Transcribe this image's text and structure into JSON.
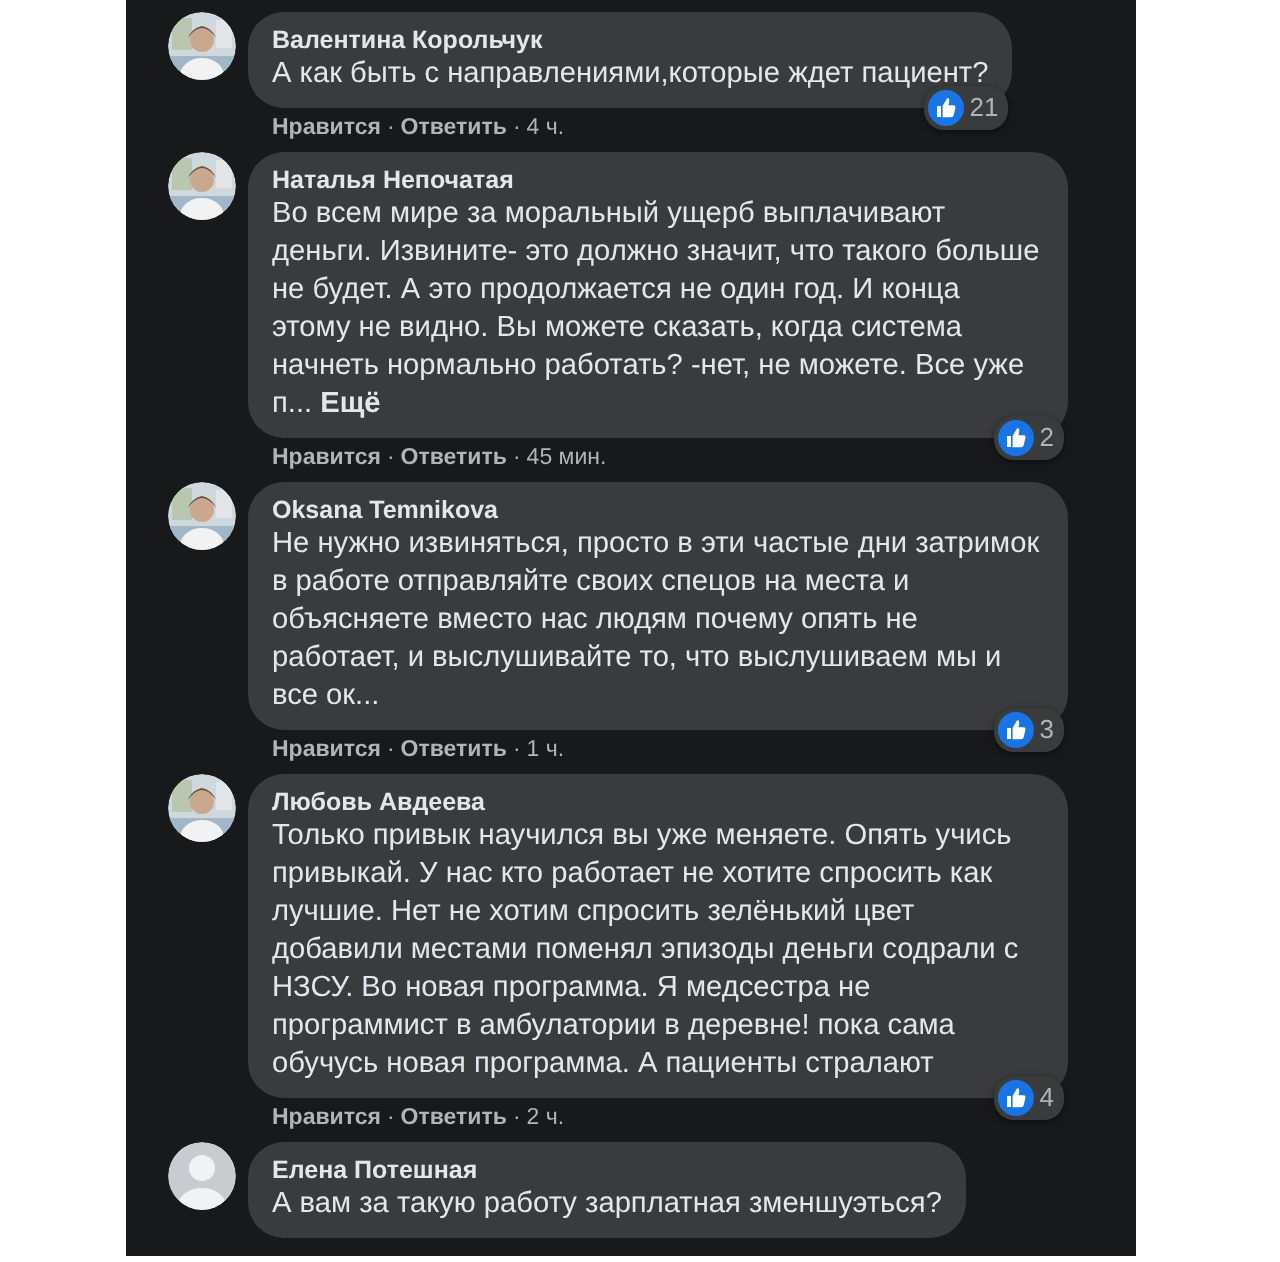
{
  "comments": [
    {
      "author": "Валентина Корольчук",
      "text": "А как быть с направлениями,которые ждет пациент?",
      "likes": "21",
      "like": "Нравится",
      "sep": "·",
      "reply": "Ответить",
      "time": "4 ч."
    },
    {
      "author": "Наталья Непочатая",
      "text": "Во всем мире за моральный ущерб выплачивают деньги. Извините- это должно значит, что такого больше не будет. А это продолжается не один год. И конца этому не видно. Вы можете сказать, когда система начнеть нормально работать? -нет, не можете. Все уже п... **Ещё**",
      "likes": "2",
      "like": "Нравится",
      "sep": "·",
      "reply": "Ответить",
      "time": "45 мин."
    },
    {
      "author": "Oksana Temnikova",
      "text": "Не нужно извиняться, просто в эти частые дни затримок в работе отправляйте своих спецов на места и объясняете вместо нас людям почему опять не работает, и выслушивайте то, что выслушиваем мы и все ок...",
      "likes": "3",
      "like": "Нравится",
      "sep": "·",
      "reply": "Ответить",
      "time": "1 ч."
    },
    {
      "author": "Любовь Авдеева",
      "text": "Только привык научился вы уже меняете. Опять учись привыкай. У нас кто работает не хотите спросить как лучшие. Нет не хотим спросить зелёнький цвет добавили местами поменял эпизоды деньги содрали с НЗСУ. Во новая программа. Я медсестра не программист в амбулатории в деревне! пока сама обучусь новая программа. А пациенты стралают",
      "likes": "4",
      "like": "Нравится",
      "sep": "·",
      "reply": "Ответить",
      "time": "2 ч."
    },
    {
      "author": "Елена Потешная",
      "avatar": {
        "kind": "silhouette"
      },
      "text": "А вам за такую работу зарплатная зменшуэться?"
    }
  ]
}
